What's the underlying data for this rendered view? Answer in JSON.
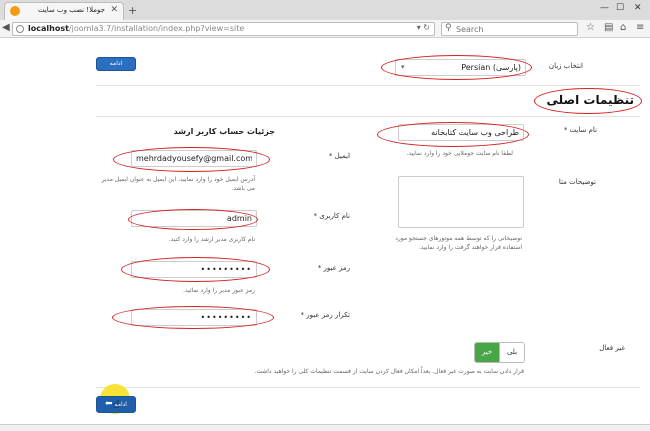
{
  "browser": {
    "tab_title": "جوملا! نصب وب سایت",
    "url_host": "localhost",
    "url_path": "/joomla3.7/installation/index.php?view=site",
    "search_placeholder": "Search"
  },
  "language": {
    "label": "انتخاب زبان",
    "selected": "Persian (پارسی)",
    "next_button": "ادامه"
  },
  "section_title": "تنظیمات اصلی",
  "site": {
    "name_label": "نام سایت *",
    "name_value": "طراحی وب سایت کتابخانه",
    "name_help": "لطفا نام سایت جوملایی خود را وارد نمایید.",
    "desc_label": "توضیحات متا",
    "desc_help": "توضیحاتی را که توسط همه موتورهای جستجو مورد استفاده قرار خواهند گرفت را وارد نمایید.",
    "offline_label": "غیر فعال",
    "offline_yes": "بلی",
    "offline_no": "خیر",
    "offline_help": "قرار دادن سایت به صورت غیر فعال. بعداً امکان فعال کردن سایت از قسمت تنظیمات کلی را خواهید داشت."
  },
  "admin": {
    "heading": "جزئیات حساب کاربر ارشد",
    "email_label": "ایمیل *",
    "email_value": "mehrdadyousefy@gmail.com",
    "email_help": "آدرس ایمیل خود را وارد نمایید، این ایمیل به عنوان ایمیل مدیر می باشد.",
    "username_label": "نام کاربری *",
    "username_value": "admin",
    "username_help": "نام کاربری مدیر ارشد را وارد کنید.",
    "password_label": "رمز عبور *",
    "password_value": "•••••••••",
    "password_help": "رمز عبور مدیر را وارد نمائید.",
    "confirm_label": "تکرار رمز عبور *",
    "confirm_value": "•••••••••"
  },
  "footer_next_button": "ادامه",
  "colors": {
    "annotation": "#d61f1f",
    "primary_button": "#2a6fc0",
    "toggle_active": "#48a548",
    "cursor_highlight": "#f5e12b"
  }
}
